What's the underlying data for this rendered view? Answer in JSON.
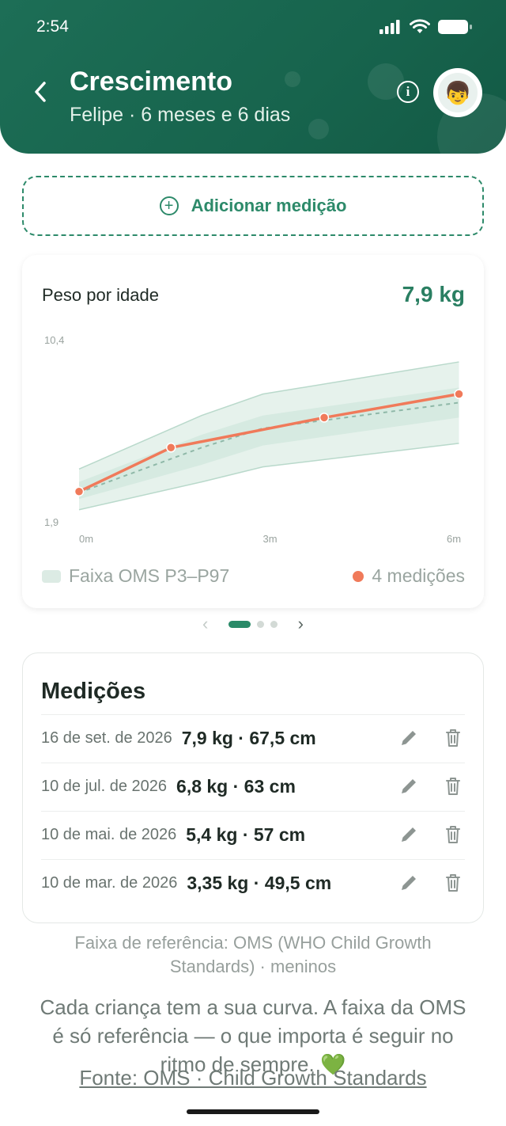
{
  "status_bar": {
    "time": "2:54"
  },
  "header": {
    "title": "Crescimento",
    "subtitle": "Felipe · 6 meses e 6 dias",
    "info_glyph": "i",
    "avatar_emoji": "👦"
  },
  "add_button": {
    "label": "Adicionar medição",
    "icon_glyph": "+"
  },
  "chart_card": {
    "title": "Peso por idade",
    "current_value": "7,9 kg",
    "legend_band": "Faixa OMS P3–P97",
    "legend_points": "4 medições",
    "colors": {
      "band_outer": "#e6f2ec",
      "band_inner": "#d6eae1",
      "line": "#f07a5a",
      "median": "#8fb8a8"
    }
  },
  "chart_data": {
    "type": "line",
    "ylabel": "",
    "xlabel": "",
    "y_ticks": [
      "10,4",
      "1,9"
    ],
    "x_ticks": [
      "0m",
      "3m",
      "6m"
    ],
    "ylim": [
      1.9,
      10.4
    ],
    "xlim": [
      0,
      6
    ],
    "series": [
      {
        "name": "medições",
        "x": [
          0,
          1.5,
          4,
          6.2
        ],
        "y": [
          3.35,
          5.4,
          6.8,
          7.9
        ]
      }
    ],
    "reference_band": {
      "x": [
        0,
        2,
        3,
        6.2
      ],
      "p3": [
        2.5,
        3.8,
        4.5,
        5.6
      ],
      "p97": [
        4.4,
        6.9,
        7.9,
        9.4
      ],
      "inner_low": [
        3.0,
        4.6,
        5.5,
        6.8
      ],
      "inner_high": [
        3.8,
        6.0,
        6.9,
        8.2
      ],
      "median": [
        3.3,
        5.4,
        6.3,
        7.5
      ]
    }
  },
  "pager": {
    "prev": "‹",
    "next": "›",
    "pages": 3,
    "active": 0
  },
  "measurements": {
    "title": "Medições",
    "rows": [
      {
        "date": "16 de set. de 2026",
        "values": "7,9 kg · 67,5 cm"
      },
      {
        "date": "10 de jul. de 2026",
        "values": "6,8 kg · 63 cm"
      },
      {
        "date": "10 de mai. de 2026",
        "values": "5,4 kg · 57 cm"
      },
      {
        "date": "10 de mar. de 2026",
        "values": "3,35 kg · 49,5 cm"
      }
    ]
  },
  "footer": {
    "reference": "Faixa de referência: OMS (WHO Child Growth Standards) · meninos",
    "note": "Cada criança tem a sua curva. A faixa da OMS é só referência — o que importa é seguir no ritmo de sempre. 💚",
    "source": "Fonte: OMS · Child Growth Standards"
  }
}
